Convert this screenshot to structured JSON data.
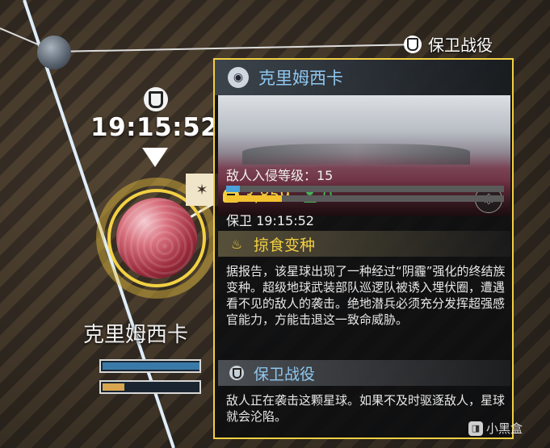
{
  "campaign_label": "保卫战役",
  "map": {
    "timer": "19:15:52",
    "planet_name": "克里姆西卡",
    "bar_top_progress": 0.98,
    "bar_bottom_progress": 0.22
  },
  "card": {
    "title": "克里姆西卡",
    "players_count": "3,859",
    "friends_count": "0",
    "invasion_label": "敌人入侵等级：15",
    "invasion_progress": 0.05,
    "defense_progress": 0.2,
    "defend_time": "保卫 19:15:52",
    "modifier_title": "掠食变种",
    "modifier_desc": "据报告，该星球出现了一种经过“阴霾”强化的终结族变种。超级地球武装部队巡逻队被诱入埋伏圈，遭遇看不见的敌人的袭击。绝地潜兵必须充分发挥超强感官能力，方能击退这一致命威胁。",
    "campaign_title": "保卫战役",
    "campaign_desc": "敌人正在袭击这颗星球。如果不及时驱逐敌人，星球就会沦陷。"
  },
  "watermark": "小黑盒",
  "colors": {
    "accent_yellow": "#f2d042",
    "title_blue": "#8fc7f0",
    "friends_green": "#3fb35a"
  },
  "icons": [
    "shield-icon",
    "planet-icon",
    "helmet-icon",
    "people-icon",
    "atom-icon",
    "fire-icon",
    "predator-icon"
  ]
}
